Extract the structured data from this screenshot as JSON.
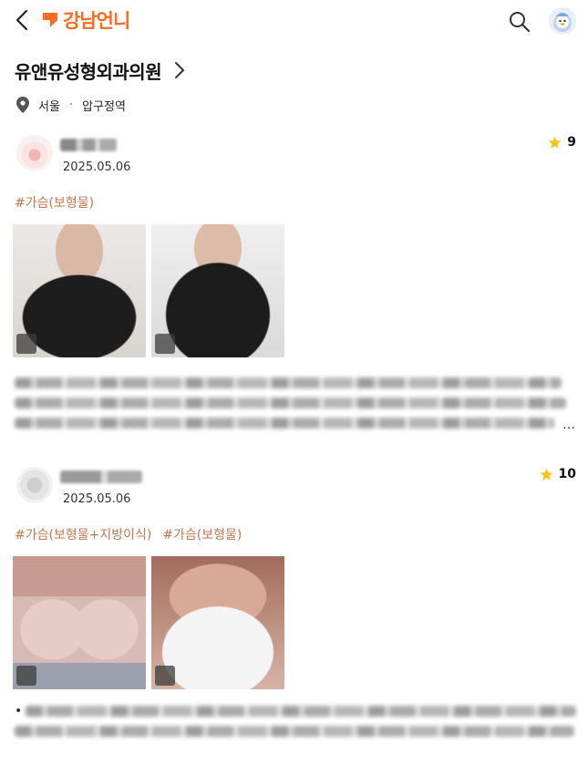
{
  "header": {
    "logo_text": "강남언니",
    "brand_color": "#ff6a1f",
    "icons": [
      "back-arrow-icon",
      "search-icon",
      "profile-avatar-icon"
    ]
  },
  "clinic": {
    "name": "유앤유성형외과의원",
    "location_city": "서울",
    "separator": "·",
    "location_station": "압구정역"
  },
  "reviews": [
    {
      "date": "2025.05.06",
      "rating": "9",
      "tags": [
        "#가슴(보형물)"
      ],
      "snippet_visible": "…"
    },
    {
      "date": "2025.05.06",
      "rating": "10",
      "tags": [
        "#가슴(보형물+지방이식)",
        "#가슴(보형물)"
      ],
      "snippet_visible": "•"
    }
  ],
  "colors": {
    "tag": "#c0794f",
    "star": "#f8c31c",
    "accent": "#ff6a1f"
  }
}
